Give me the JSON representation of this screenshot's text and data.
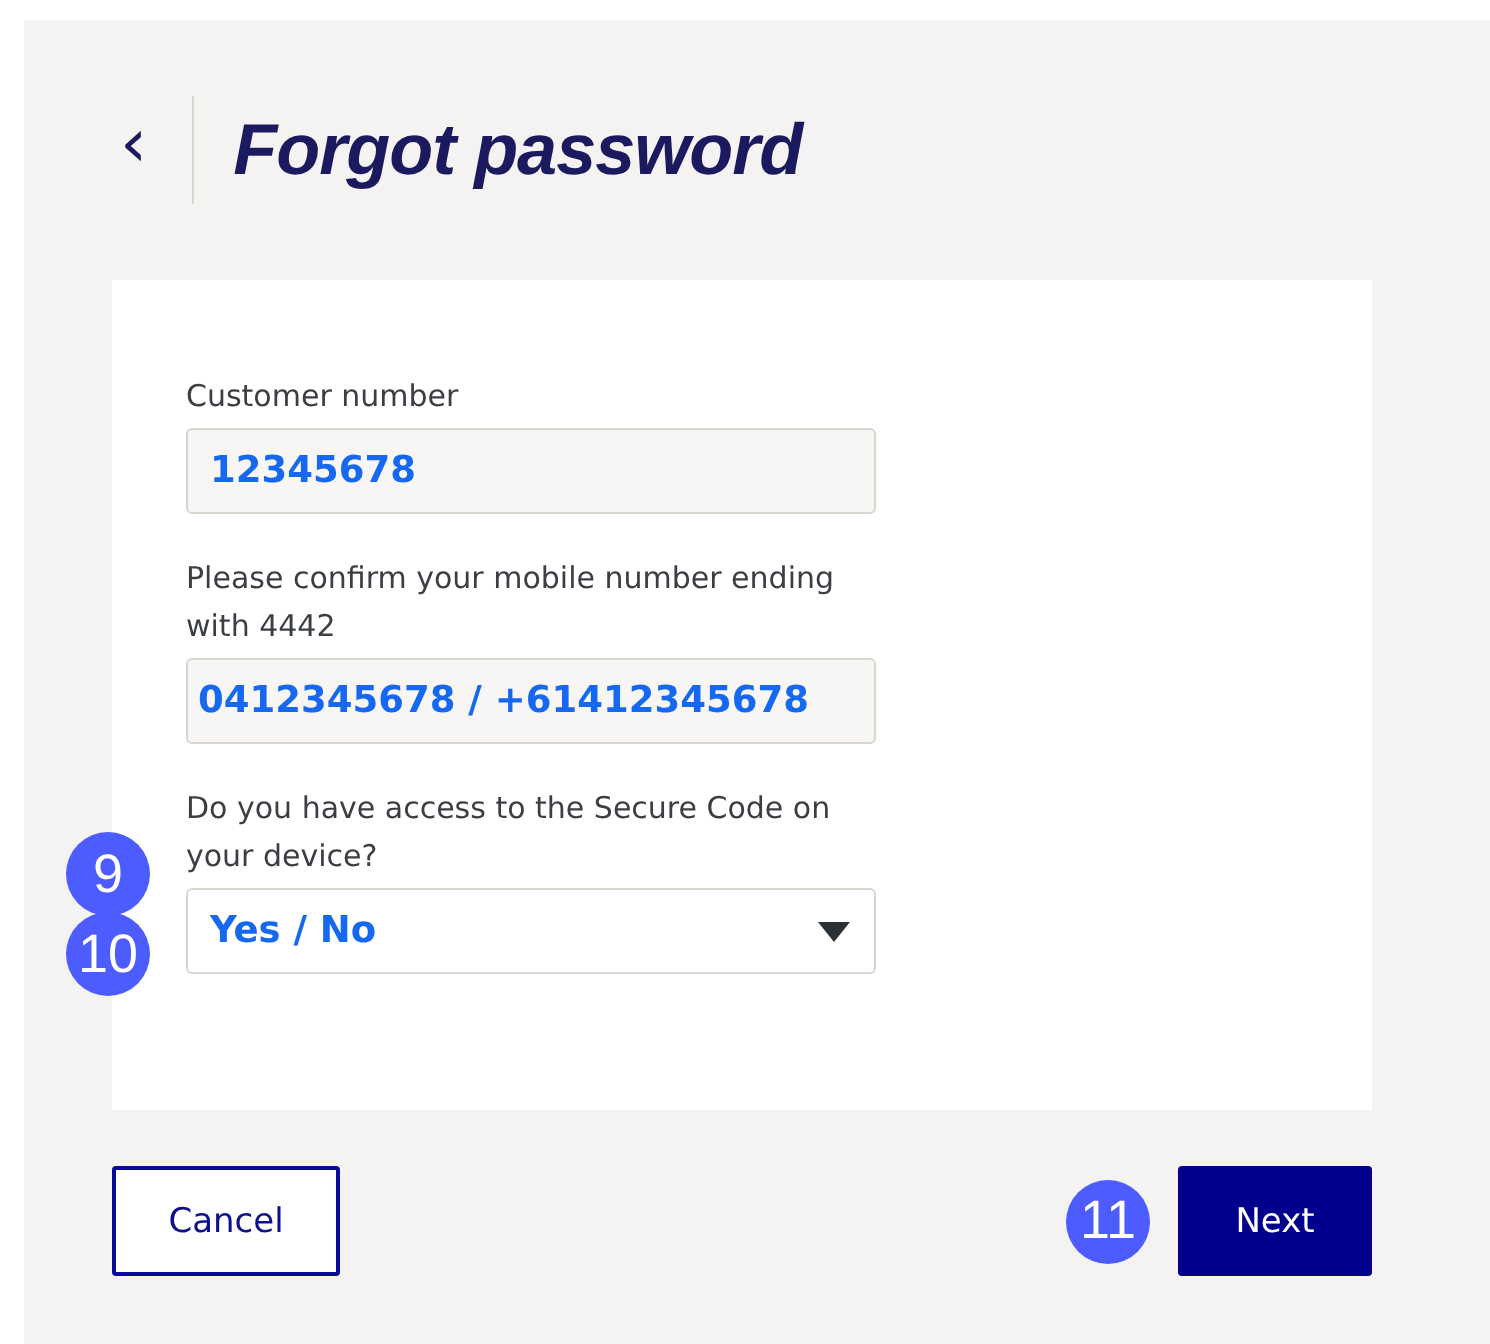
{
  "header": {
    "back_icon": "‹",
    "title": "Forgot password"
  },
  "fields": [
    {
      "kind": "text",
      "label": "Customer number",
      "value": "12345678"
    },
    {
      "kind": "text",
      "label": "Please confirm your mobile number ending with 4442",
      "value": "0412345678 / +61412345678"
    },
    {
      "kind": "select",
      "label": "Do you have access to the Secure Code on your device?",
      "value": "Yes / No",
      "markers": [
        "9",
        "10"
      ]
    }
  ],
  "buttons": [
    {
      "label": "Cancel",
      "kind": "secondary"
    },
    {
      "label": "Next",
      "kind": "primary",
      "markers": [
        "11"
      ]
    }
  ]
}
